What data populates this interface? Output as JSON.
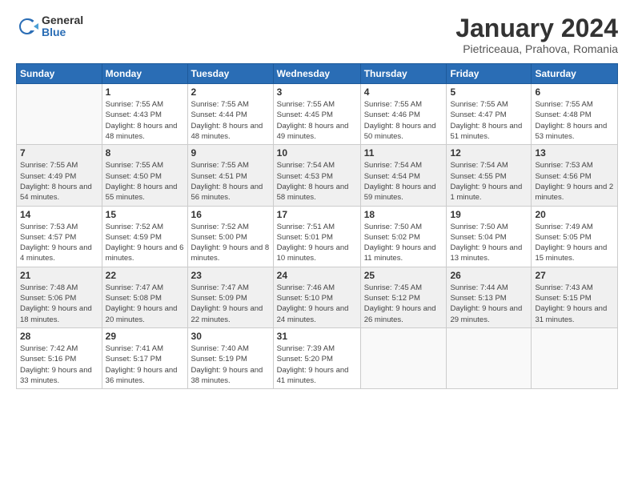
{
  "header": {
    "logo_general": "General",
    "logo_blue": "Blue",
    "month_title": "January 2024",
    "subtitle": "Pietriceaua, Prahova, Romania"
  },
  "days_of_week": [
    "Sunday",
    "Monday",
    "Tuesday",
    "Wednesday",
    "Thursday",
    "Friday",
    "Saturday"
  ],
  "weeks": [
    [
      {
        "day": "",
        "sunrise": "",
        "sunset": "",
        "daylight": ""
      },
      {
        "day": "1",
        "sunrise": "Sunrise: 7:55 AM",
        "sunset": "Sunset: 4:43 PM",
        "daylight": "Daylight: 8 hours and 48 minutes."
      },
      {
        "day": "2",
        "sunrise": "Sunrise: 7:55 AM",
        "sunset": "Sunset: 4:44 PM",
        "daylight": "Daylight: 8 hours and 48 minutes."
      },
      {
        "day": "3",
        "sunrise": "Sunrise: 7:55 AM",
        "sunset": "Sunset: 4:45 PM",
        "daylight": "Daylight: 8 hours and 49 minutes."
      },
      {
        "day": "4",
        "sunrise": "Sunrise: 7:55 AM",
        "sunset": "Sunset: 4:46 PM",
        "daylight": "Daylight: 8 hours and 50 minutes."
      },
      {
        "day": "5",
        "sunrise": "Sunrise: 7:55 AM",
        "sunset": "Sunset: 4:47 PM",
        "daylight": "Daylight: 8 hours and 51 minutes."
      },
      {
        "day": "6",
        "sunrise": "Sunrise: 7:55 AM",
        "sunset": "Sunset: 4:48 PM",
        "daylight": "Daylight: 8 hours and 53 minutes."
      }
    ],
    [
      {
        "day": "7",
        "sunrise": "Sunrise: 7:55 AM",
        "sunset": "Sunset: 4:49 PM",
        "daylight": "Daylight: 8 hours and 54 minutes."
      },
      {
        "day": "8",
        "sunrise": "Sunrise: 7:55 AM",
        "sunset": "Sunset: 4:50 PM",
        "daylight": "Daylight: 8 hours and 55 minutes."
      },
      {
        "day": "9",
        "sunrise": "Sunrise: 7:55 AM",
        "sunset": "Sunset: 4:51 PM",
        "daylight": "Daylight: 8 hours and 56 minutes."
      },
      {
        "day": "10",
        "sunrise": "Sunrise: 7:54 AM",
        "sunset": "Sunset: 4:53 PM",
        "daylight": "Daylight: 8 hours and 58 minutes."
      },
      {
        "day": "11",
        "sunrise": "Sunrise: 7:54 AM",
        "sunset": "Sunset: 4:54 PM",
        "daylight": "Daylight: 8 hours and 59 minutes."
      },
      {
        "day": "12",
        "sunrise": "Sunrise: 7:54 AM",
        "sunset": "Sunset: 4:55 PM",
        "daylight": "Daylight: 9 hours and 1 minute."
      },
      {
        "day": "13",
        "sunrise": "Sunrise: 7:53 AM",
        "sunset": "Sunset: 4:56 PM",
        "daylight": "Daylight: 9 hours and 2 minutes."
      }
    ],
    [
      {
        "day": "14",
        "sunrise": "Sunrise: 7:53 AM",
        "sunset": "Sunset: 4:57 PM",
        "daylight": "Daylight: 9 hours and 4 minutes."
      },
      {
        "day": "15",
        "sunrise": "Sunrise: 7:52 AM",
        "sunset": "Sunset: 4:59 PM",
        "daylight": "Daylight: 9 hours and 6 minutes."
      },
      {
        "day": "16",
        "sunrise": "Sunrise: 7:52 AM",
        "sunset": "Sunset: 5:00 PM",
        "daylight": "Daylight: 9 hours and 8 minutes."
      },
      {
        "day": "17",
        "sunrise": "Sunrise: 7:51 AM",
        "sunset": "Sunset: 5:01 PM",
        "daylight": "Daylight: 9 hours and 10 minutes."
      },
      {
        "day": "18",
        "sunrise": "Sunrise: 7:50 AM",
        "sunset": "Sunset: 5:02 PM",
        "daylight": "Daylight: 9 hours and 11 minutes."
      },
      {
        "day": "19",
        "sunrise": "Sunrise: 7:50 AM",
        "sunset": "Sunset: 5:04 PM",
        "daylight": "Daylight: 9 hours and 13 minutes."
      },
      {
        "day": "20",
        "sunrise": "Sunrise: 7:49 AM",
        "sunset": "Sunset: 5:05 PM",
        "daylight": "Daylight: 9 hours and 15 minutes."
      }
    ],
    [
      {
        "day": "21",
        "sunrise": "Sunrise: 7:48 AM",
        "sunset": "Sunset: 5:06 PM",
        "daylight": "Daylight: 9 hours and 18 minutes."
      },
      {
        "day": "22",
        "sunrise": "Sunrise: 7:47 AM",
        "sunset": "Sunset: 5:08 PM",
        "daylight": "Daylight: 9 hours and 20 minutes."
      },
      {
        "day": "23",
        "sunrise": "Sunrise: 7:47 AM",
        "sunset": "Sunset: 5:09 PM",
        "daylight": "Daylight: 9 hours and 22 minutes."
      },
      {
        "day": "24",
        "sunrise": "Sunrise: 7:46 AM",
        "sunset": "Sunset: 5:10 PM",
        "daylight": "Daylight: 9 hours and 24 minutes."
      },
      {
        "day": "25",
        "sunrise": "Sunrise: 7:45 AM",
        "sunset": "Sunset: 5:12 PM",
        "daylight": "Daylight: 9 hours and 26 minutes."
      },
      {
        "day": "26",
        "sunrise": "Sunrise: 7:44 AM",
        "sunset": "Sunset: 5:13 PM",
        "daylight": "Daylight: 9 hours and 29 minutes."
      },
      {
        "day": "27",
        "sunrise": "Sunrise: 7:43 AM",
        "sunset": "Sunset: 5:15 PM",
        "daylight": "Daylight: 9 hours and 31 minutes."
      }
    ],
    [
      {
        "day": "28",
        "sunrise": "Sunrise: 7:42 AM",
        "sunset": "Sunset: 5:16 PM",
        "daylight": "Daylight: 9 hours and 33 minutes."
      },
      {
        "day": "29",
        "sunrise": "Sunrise: 7:41 AM",
        "sunset": "Sunset: 5:17 PM",
        "daylight": "Daylight: 9 hours and 36 minutes."
      },
      {
        "day": "30",
        "sunrise": "Sunrise: 7:40 AM",
        "sunset": "Sunset: 5:19 PM",
        "daylight": "Daylight: 9 hours and 38 minutes."
      },
      {
        "day": "31",
        "sunrise": "Sunrise: 7:39 AM",
        "sunset": "Sunset: 5:20 PM",
        "daylight": "Daylight: 9 hours and 41 minutes."
      },
      {
        "day": "",
        "sunrise": "",
        "sunset": "",
        "daylight": ""
      },
      {
        "day": "",
        "sunrise": "",
        "sunset": "",
        "daylight": ""
      },
      {
        "day": "",
        "sunrise": "",
        "sunset": "",
        "daylight": ""
      }
    ]
  ]
}
